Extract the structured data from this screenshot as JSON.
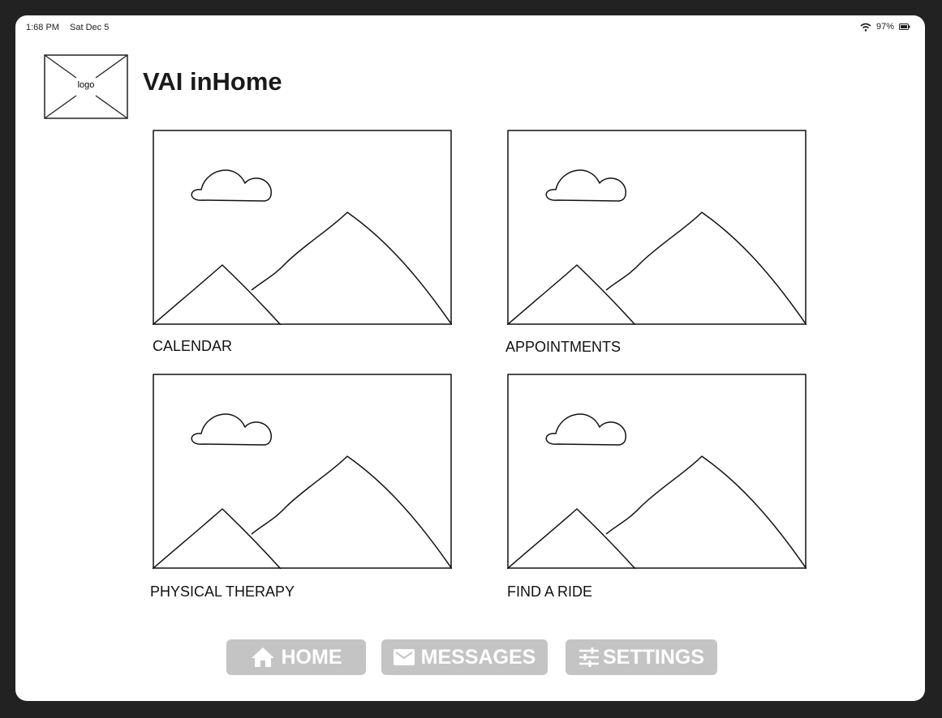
{
  "status_bar": {
    "time": "1:68 PM",
    "date": "Sat Dec 5",
    "battery": "97%"
  },
  "header": {
    "logo_text": "logo",
    "title": "VAI inHome"
  },
  "tiles": [
    {
      "label": "CALENDAR"
    },
    {
      "label": "APPOINTMENTS"
    },
    {
      "label": "PHYSICAL THERAPY"
    },
    {
      "label": "FIND A RIDE"
    }
  ],
  "nav": {
    "home": "HOME",
    "messages": "MESSAGES",
    "settings": "SETTINGS",
    "button_color": "#c4c4c4"
  }
}
